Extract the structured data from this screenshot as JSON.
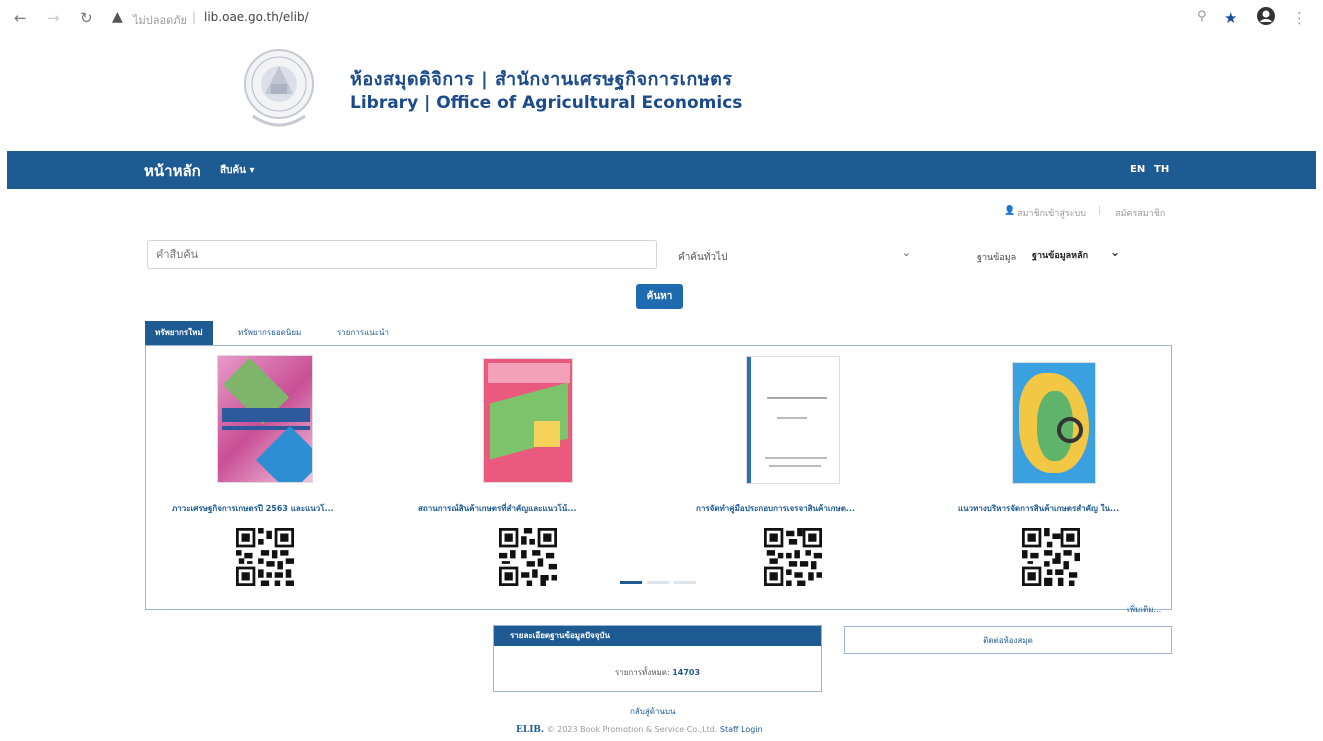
{
  "browser": {
    "url": "lib.oae.go.th/elib/",
    "security_text": "ไม่ปลอดภัย",
    "icons": [
      "back-arrow-icon",
      "forward-arrow-icon",
      "reload-icon",
      "warning-icon",
      "zoom-icon",
      "star-icon",
      "account-icon",
      "menu-dots-icon"
    ]
  },
  "header": {
    "title_th": "ห้องสมุดดิจิการ | สำนักงานเศรษฐกิจการเกษตร",
    "title_en": "Library | Office of Agricultural Economics"
  },
  "navbar": {
    "home": "หน้าหลัก",
    "search_menu": "สืบค้น ▾",
    "lang_en": "EN",
    "lang_th": "TH"
  },
  "userbar": {
    "login": "สมาชิกเข้าสู่ระบบ",
    "register": "สมัครสมาชิก"
  },
  "search": {
    "placeholder": "คำสืบค้น",
    "type_value": "คำค้นทั่วไป",
    "db_label": "ฐานข้อมูล",
    "db_value": "ฐานข้อมูลหลัก",
    "button": "ค้นหา"
  },
  "tabs": [
    {
      "label": "ทรัพยากรใหม่"
    },
    {
      "label": "ทรัพยากรยอดนิยม"
    },
    {
      "label": "รายการแนะนำ"
    }
  ],
  "books": [
    {
      "title": "ภาวะเศรษฐกิจการเกษตรปี 2563 และแนวโ..."
    },
    {
      "title": "สถานการณ์สินค้าเกษตรที่สำคัญและแนวโน้..."
    },
    {
      "title": "การจัดทำคู่มือประกอบการเจรจาสินค้าเกษต..."
    },
    {
      "title": "แนวทางบริหารจัดการสินค้าเกษตรสำคัญ ใน..."
    }
  ],
  "more": "เพิ่มเติม...",
  "database_info": {
    "header": "รายละเอียดฐานข้อมูลปัจจุบัน",
    "total_label": "รายการทั้งหมด:",
    "total_value": "14703"
  },
  "library_contact": "ติดต่อห้องสมุด",
  "back_to_top": "กลับสู่ด้านบน",
  "footer": {
    "brand": "ELIB.",
    "copyright": "© 2023 Book Promotion & Service Co.,Ltd.",
    "staff_login": "Staff Login"
  },
  "colors": {
    "primary": "#1f5b93",
    "button": "#1f6bb0"
  }
}
